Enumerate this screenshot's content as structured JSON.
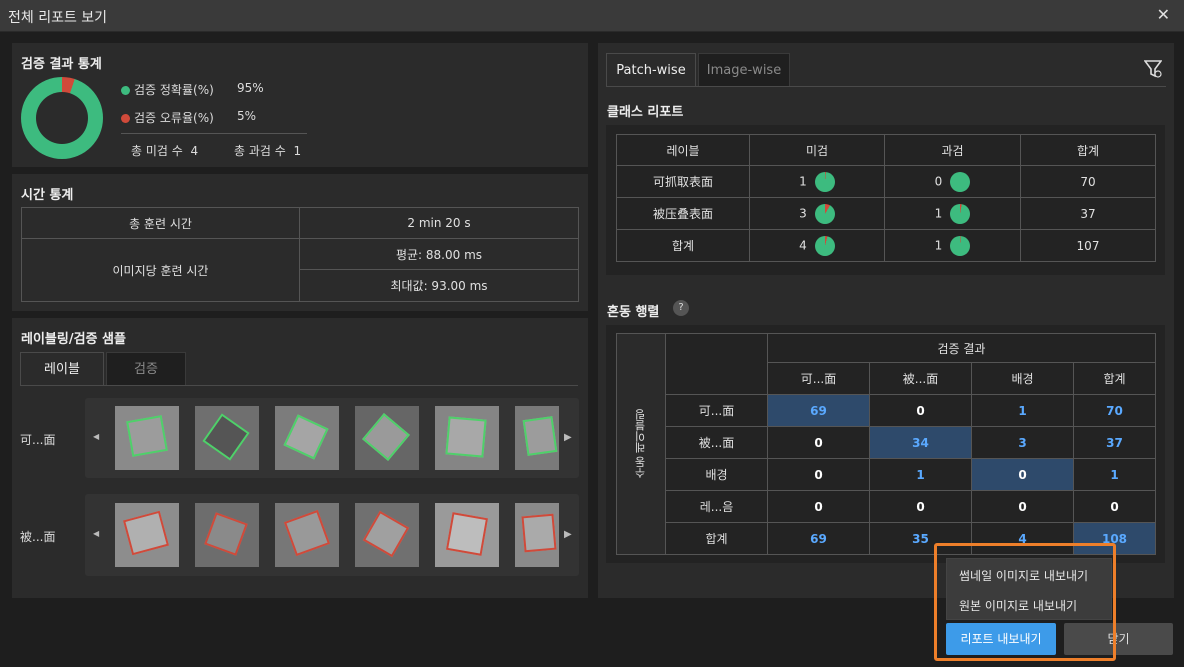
{
  "window": {
    "title": "전체 리포트 보기",
    "close_icon": "✕"
  },
  "stats": {
    "title": "검증 결과 통계",
    "accuracy_label": "검증 정확률(%)",
    "accuracy_value": "95%",
    "accuracy_fraction": 0.95,
    "error_label": "검증 오류율(%)",
    "error_value": "5%",
    "accuracy_color": "#3dbb7f",
    "error_color": "#d04a3a",
    "miss_label": "총 미검 수",
    "miss_value": "4",
    "over_label": "총 과검 수",
    "over_value": "1"
  },
  "time": {
    "title": "시간 통계",
    "total_label": "총 훈련 시간",
    "total_value": "2 min 20 s",
    "per_image_label": "이미지당 훈련 시간",
    "avg_value": "평균: 88.00 ms",
    "max_value": "최대값: 93.00 ms"
  },
  "samples": {
    "title": "레이블링/검증 샘플",
    "tab_label": "레이블",
    "tab_verify": "검증",
    "row1_label": "可...面",
    "row2_label": "被...面",
    "left_arrow": "◀",
    "right_arrow": "▶"
  },
  "tabs": {
    "patch": "Patch-wise",
    "image": "Image-wise"
  },
  "filter_icon": "filter-icon",
  "class_report": {
    "title": "클래스 리포트",
    "headers": [
      "레이블",
      "미검",
      "과검",
      "합계"
    ],
    "rows": [
      {
        "label": "可抓取表面",
        "miss": "1",
        "over": "0",
        "total": "70"
      },
      {
        "label": "被压叠表面",
        "miss": "3",
        "over": "1",
        "total": "37"
      },
      {
        "label": "합계",
        "miss": "4",
        "over": "1",
        "total": "107"
      }
    ]
  },
  "confusion": {
    "title": "혼동 행렬",
    "help_icon": "?",
    "col_group": "검증 결과",
    "row_group": "수동 레이블링",
    "col_headers": [
      "可...面",
      "被...面",
      "배경",
      "합계"
    ],
    "rows": [
      {
        "label": "可...面",
        "cells": [
          "69",
          "0",
          "1",
          "70"
        ]
      },
      {
        "label": "被...面",
        "cells": [
          "0",
          "34",
          "3",
          "37"
        ]
      },
      {
        "label": "배경",
        "cells": [
          "0",
          "1",
          "0",
          "1"
        ]
      },
      {
        "label": "레...음",
        "cells": [
          "0",
          "0",
          "0",
          "0"
        ]
      },
      {
        "label": "합계",
        "cells": [
          "69",
          "35",
          "4",
          "108"
        ]
      }
    ]
  },
  "export_menu": {
    "thumbnail": "썸네일 이미지로 내보내기",
    "original": "원본 이미지로 내보내기"
  },
  "buttons": {
    "export": "리포트 내보내기",
    "close": "닫기"
  }
}
